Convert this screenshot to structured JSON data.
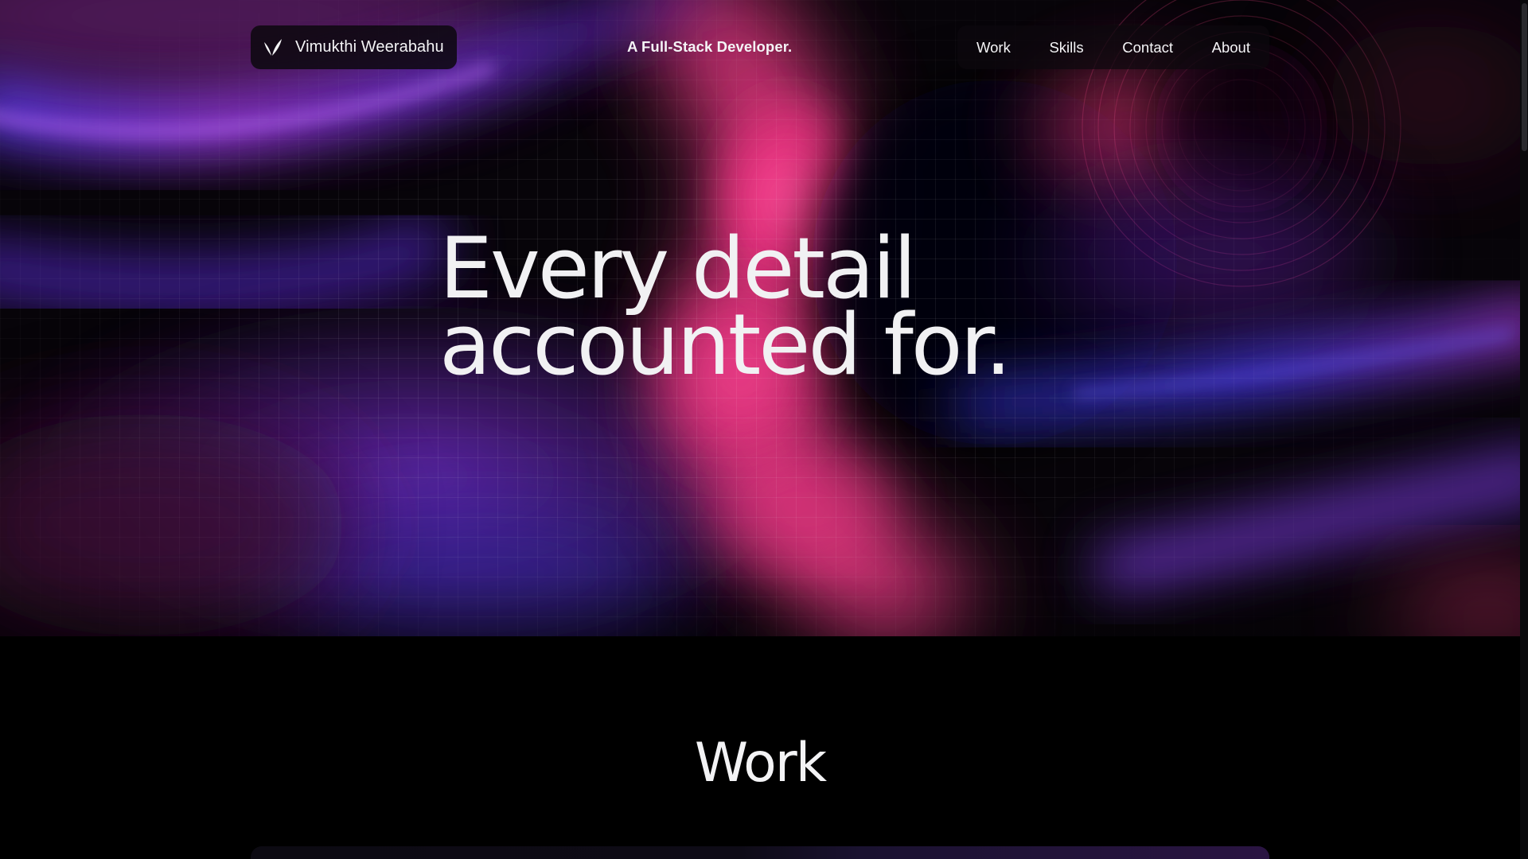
{
  "brand": {
    "name": "Vimukthi Weerabahu",
    "icon": "leaf-logo-icon"
  },
  "tagline": "A Full-Stack Developer.",
  "nav": {
    "items": [
      {
        "label": "Work"
      },
      {
        "label": "Skills"
      },
      {
        "label": "Contact"
      },
      {
        "label": "About"
      }
    ]
  },
  "hero": {
    "headline_line1": "Every detail",
    "headline_line2": "accounted for."
  },
  "work": {
    "title": "Work"
  },
  "colors": {
    "background": "#000000",
    "accent_pink": "#ff3c8c",
    "accent_purple": "#9b3cff",
    "accent_blue": "#3c3cff",
    "text": "#f2f2f4"
  }
}
